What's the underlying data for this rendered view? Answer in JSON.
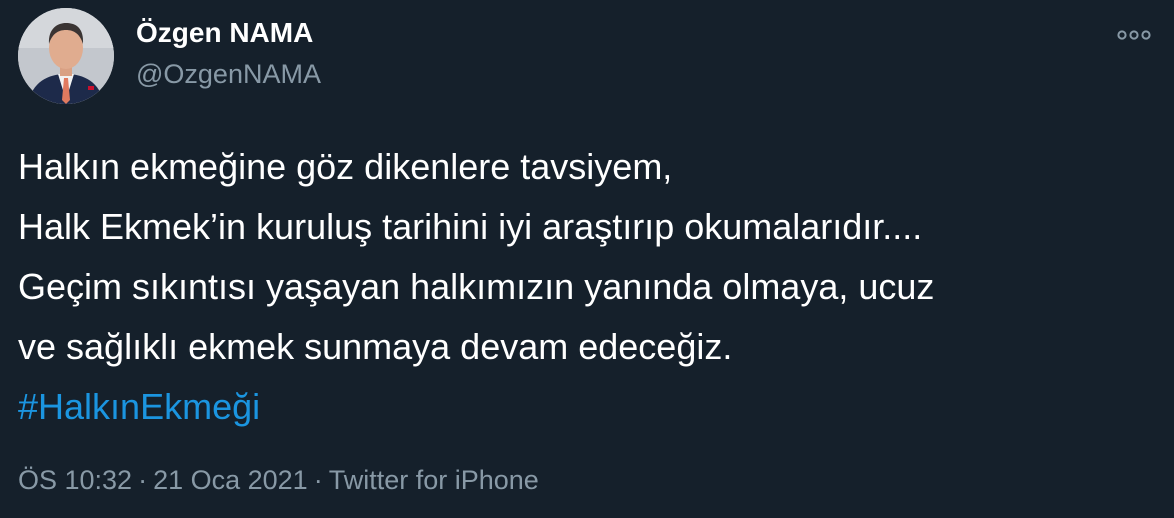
{
  "author": {
    "display_name": "Özgen NAMA",
    "handle": "@OzgenNAMA"
  },
  "more_icon": "more-horizontal-icon",
  "tweet": {
    "lines": [
      "Halkın ekmeğine göz dikenlere tavsiyem,",
      "Halk Ekmek’in kuruluş tarihini iyi araştırıp okumalarıdır....",
      "Geçim sıkıntısı yaşayan halkımızın yanında olmaya, ucuz",
      "ve sağlıklı ekmek sunmaya devam edeceğiz."
    ],
    "hashtag": "#HalkınEkmeği"
  },
  "meta": {
    "time": "ÖS 10:32",
    "separator": "·",
    "date": "21 Oca 2021",
    "source": "Twitter for iPhone"
  },
  "colors": {
    "background": "#15202b",
    "text": "#ffffff",
    "secondary": "#8899a6",
    "link": "#1b95e0"
  }
}
